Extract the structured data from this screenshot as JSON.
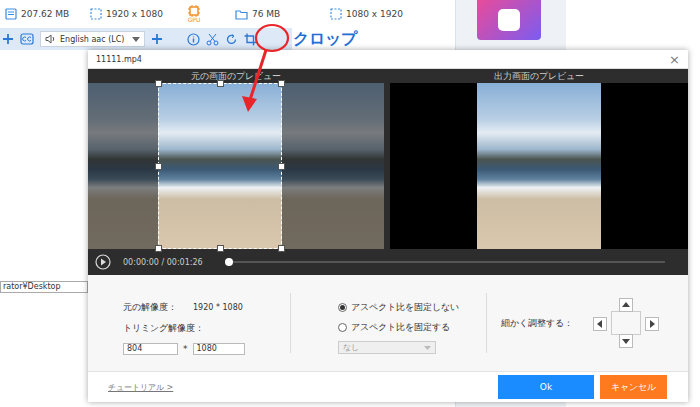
{
  "app": {
    "file_info": [
      {
        "kind": "source-size",
        "text": "207.62 MB"
      },
      {
        "kind": "resolution",
        "text": "1920 x 1080"
      },
      {
        "kind": "gpu",
        "text": "GPU"
      },
      {
        "kind": "output-size",
        "text": "76 MB"
      },
      {
        "kind": "resolution",
        "text": "1080 x 1920"
      }
    ],
    "audio_track": "English aac (LC)",
    "output_path": "rator¥Desktop"
  },
  "annotation": {
    "label": "クロップ"
  },
  "dialog": {
    "title": "11111.mp4",
    "close": "×",
    "source_header": "元の画面のプレビュー",
    "output_header": "出力画面のプレビュー",
    "crop": {
      "start": 0.236,
      "share": 0.419
    },
    "player": {
      "time": "00:00:00 / 00:01:26",
      "level": 0
    },
    "original_resolution": {
      "label": "元の解像度：",
      "value": "1920 * 1080"
    },
    "trim_resolution": {
      "label": "トリミング解像度：",
      "width": "804",
      "separator": "*",
      "height": "1080"
    },
    "aspect_options": [
      {
        "label": "アスペクト比を固定しない",
        "selected": true
      },
      {
        "label": "アスペクト比を固定する",
        "selected": false
      }
    ],
    "ratio_select": {
      "value": "なし",
      "disabled": true
    },
    "fine_adjust": {
      "label": "細かく調整する："
    },
    "tutorial": "チュートリアル >",
    "buttons": [
      {
        "label": "Ok",
        "kind": "primary"
      },
      {
        "label": "キャンセル",
        "kind": "cancel"
      }
    ]
  }
}
